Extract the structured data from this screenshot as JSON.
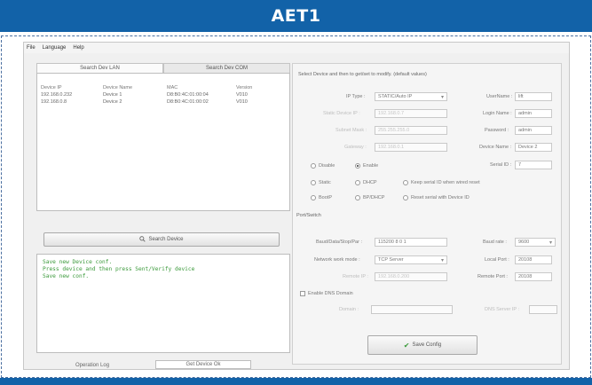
{
  "banner": {
    "title": "AET1"
  },
  "menu": [
    "File",
    "Language",
    "Help"
  ],
  "tabs": [
    "Search Dev LAN",
    "Search Dev COM"
  ],
  "device_table": {
    "headers": [
      "Device IP",
      "Device Name",
      "MAC",
      "Version"
    ],
    "rows": [
      [
        "192.168.0.232",
        "Device 1",
        "D8:B0:4C:01:00:04",
        "V010"
      ],
      [
        "192.168.0.8",
        "Device 2",
        "D8:B0:4C:01:00:02",
        "V010"
      ]
    ]
  },
  "search_button": {
    "icon": "search-icon",
    "label": "Search Device"
  },
  "log_lines": [
    "Save new Device conf.",
    "Press device and then press Sent/Verify device",
    "Save new conf."
  ],
  "footer": {
    "operation_label": "Operation Log",
    "status_value": "Get Device Ok"
  },
  "right": {
    "hint": "Select Device and then to get/set to modify. (default values)",
    "ip_type_label": "IP Type :",
    "ip_type_value": "STATIC/Auto IP",
    "static_ip_label": "Static Device IP :",
    "static_ip_value": "192.168.0.7",
    "subnet_label": "Subnet Mask :",
    "subnet_value": "255.255.255.0",
    "gateway_label": "Gateway :",
    "gateway_value": "192.168.0.1",
    "username_label": "UserName :",
    "username_value": "lift",
    "loginname_label": "Login Name :",
    "loginname_value": "admin",
    "password_label": "Password :",
    "password_value": "admin",
    "devicename_label": "Device Name :",
    "devicename_value": "Device 2",
    "serial_label": "Serial ID :",
    "serial_value": "7",
    "radio_disable": "Disable",
    "radio_enable": "Enable",
    "radio_static": "Static",
    "radio_dhcp": "DHCP",
    "radio_bootp": "BootP",
    "radio_bootp_dhcp": "BP/DHCP",
    "radio_keep": "Keep serial ID when wired reset",
    "radio_clear": "Reset serial with Device ID",
    "port_group": "Port/Switch",
    "baud_label": "Baud/Data/Stop/Par :",
    "baud_value": "115200  8  0  1",
    "work_mode_label": "Network work mode :",
    "work_mode_value": "TCP Server",
    "remote_ip_label": "Remote IP :",
    "remote_ip_value": "192.168.0.200",
    "baud_rate_label": "Baud rate :",
    "baud_rate_value": "9600",
    "local_port_label": "Local Port :",
    "local_port_value": "20108",
    "remote_port_label": "Remote Port :",
    "remote_port_value": "20108",
    "enable_dns_label": "Enable DNS Domain",
    "domain_label": "Domain :",
    "domain_value": "",
    "dns_server_label": "DNS Server IP :",
    "dns_server_value": "",
    "save_button": "Save Config"
  }
}
